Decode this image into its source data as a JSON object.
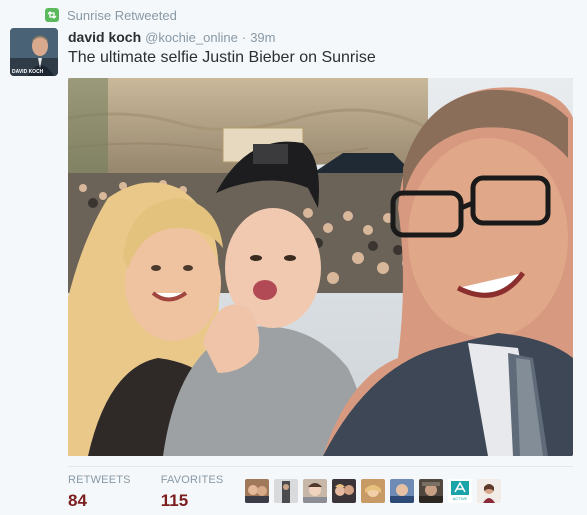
{
  "retweet": {
    "label": "Sunrise Retweeted"
  },
  "tweet": {
    "author": {
      "name": "david koch",
      "handle": "@kochie_online",
      "avatar_caption": "DAVID KOCH"
    },
    "separator": "·",
    "time": "39m",
    "text": "The ultimate selfie Justin Bieber on Sunrise"
  },
  "stats": {
    "retweets_label": "RETWEETS",
    "retweets_count": "84",
    "favorites_label": "FAVORITES",
    "favorites_count": "115"
  },
  "favoriters": {
    "avatars": [
      "user-avatar",
      "user-avatar",
      "user-avatar",
      "user-avatar",
      "user-avatar",
      "user-avatar",
      "user-avatar",
      "active-logo-avatar",
      "user-avatar"
    ],
    "logo_text": "ACTIVE"
  },
  "colors": {
    "retweet_green": "#5cb85c",
    "count_color": "#7a1e1e",
    "meta_gray": "#8899a6"
  }
}
